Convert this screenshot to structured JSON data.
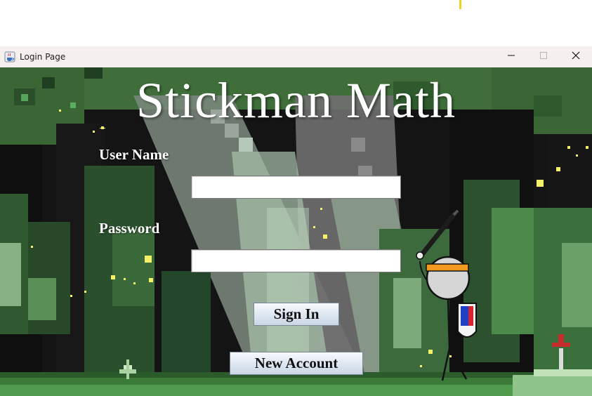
{
  "window": {
    "title": "Login Page",
    "controls": {
      "minimize_icon": "minimize-icon",
      "maximize_icon": "maximize-icon",
      "close_icon": "close-icon"
    }
  },
  "login": {
    "heading": "Stickman Math",
    "username_label": "User Name",
    "username_value": "",
    "password_label": "Password",
    "password_value": "",
    "sign_in_label": "Sign In",
    "new_account_label": "New Account"
  },
  "scene": {
    "background": "pixel-art forest",
    "character": "stickman with sword and shield",
    "colors": {
      "canopy": "#3f6e3a",
      "tree_dark": "#101010",
      "light_beam": "#9bb79d",
      "headband": "#f29a1d",
      "shield_blue": "#1f3fc7",
      "shield_red": "#d8232f",
      "sprite_red": "#c62b2b",
      "firefly": "#f4f06a"
    }
  }
}
